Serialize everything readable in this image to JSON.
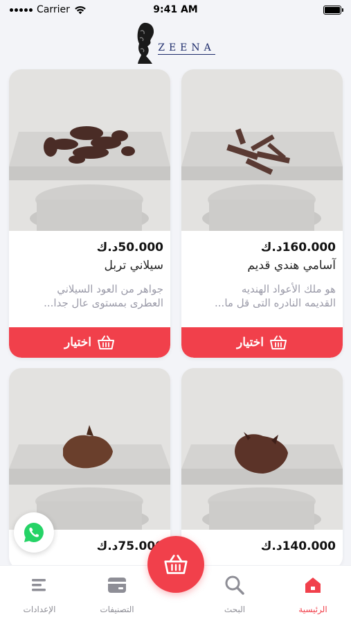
{
  "status_bar": {
    "carrier": "Carrier",
    "time": "9:41 AM"
  },
  "brand": {
    "logo_text": "ZEENA",
    "accent_color": "#f1404b",
    "logo_color": "#1d2b6b"
  },
  "products": [
    {
      "price": "160.000د.ك",
      "name": "آسامي هندي قديم",
      "description_line1": "هو ملك الأعواد الهنديه",
      "description_line2": "القديمه النادره التى قل ما...",
      "button_label": "اختيار",
      "button_icon": "basket-icon"
    },
    {
      "price": "50.000د.ك",
      "name": "سيلاني تربل",
      "description_line1": "جواهر من العود السيلاني",
      "description_line2": "العطرى بمستوى عال جدا...",
      "button_label": "اختيار",
      "button_icon": "basket-icon"
    },
    {
      "price": "140.000د.ك"
    },
    {
      "price": "75.000د.ك"
    }
  ],
  "bottom_nav": {
    "items": [
      {
        "label": "الرئيسية",
        "icon": "home-icon",
        "active": true
      },
      {
        "label": "البحث",
        "icon": "search-icon",
        "active": false
      },
      {
        "label": "التصنيفات",
        "icon": "categories-icon",
        "active": false
      },
      {
        "label": "الإعدادات",
        "icon": "settings-menu-icon",
        "active": false
      }
    ]
  },
  "fab": {
    "icon": "basket-icon"
  },
  "whatsapp": {
    "icon": "whatsapp-icon"
  }
}
